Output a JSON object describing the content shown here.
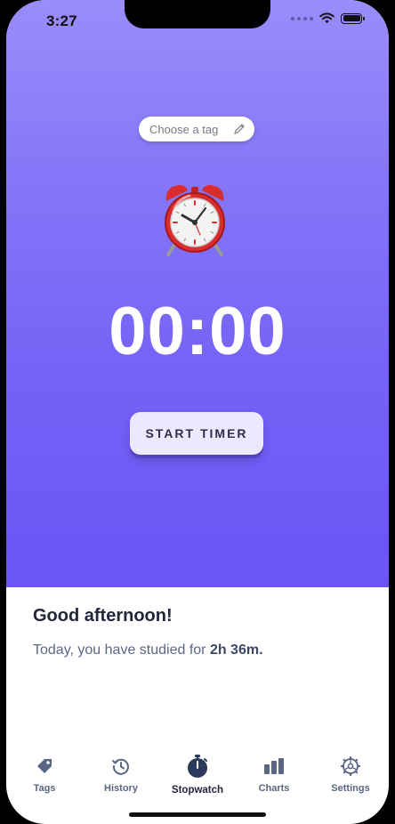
{
  "status_bar": {
    "time": "3:27"
  },
  "tag_picker": {
    "label": "Choose a tag",
    "icon": "pencil-icon"
  },
  "hero": {
    "icon": "alarm-clock-icon",
    "timer": "00:00",
    "start_label": "START TIMER"
  },
  "summary": {
    "greeting": "Good afternoon!",
    "studied_prefix": "Today, you have studied for ",
    "studied_value": "2h 36m."
  },
  "tabs": [
    {
      "label": "Tags",
      "icon": "tag-icon"
    },
    {
      "label": "History",
      "icon": "history-icon"
    },
    {
      "label": "Stopwatch",
      "icon": "stopwatch-icon",
      "active": true
    },
    {
      "label": "Charts",
      "icon": "bar-chart-icon"
    },
    {
      "label": "Settings",
      "icon": "gear-icon"
    }
  ],
  "colors": {
    "hero_top": "#9b8cfb",
    "hero_bottom": "#6b55f5",
    "button_bg": "#ece8fd",
    "text_dark": "#22263a",
    "tab_icon": "#5a6684",
    "tab_active": "#2b3a5c"
  }
}
